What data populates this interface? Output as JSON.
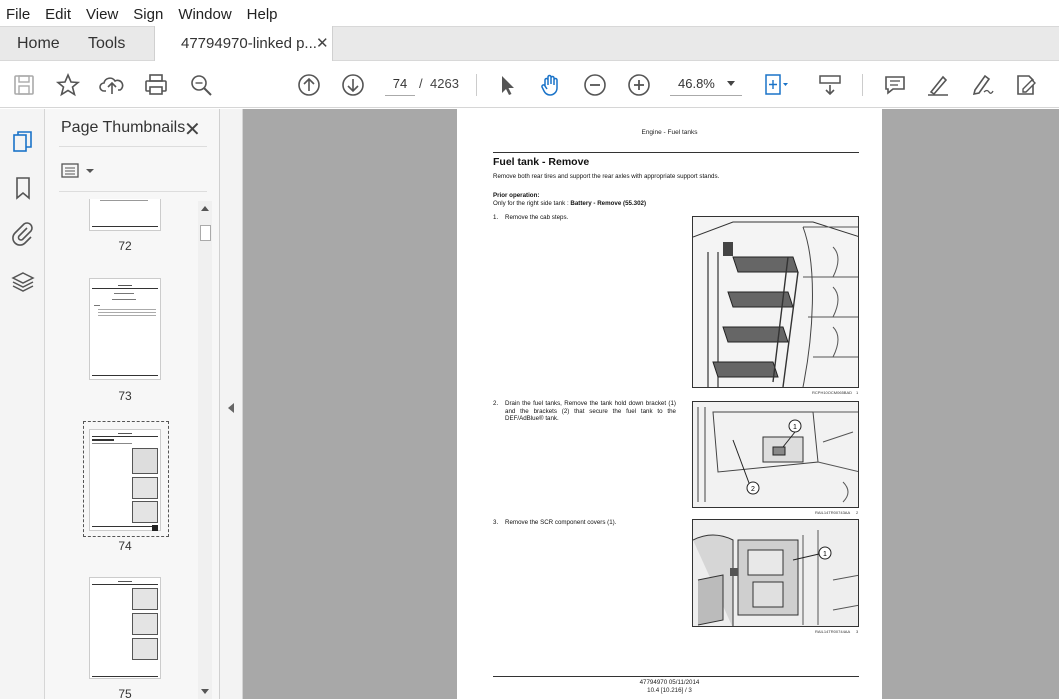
{
  "menu": [
    "File",
    "Edit",
    "View",
    "Sign",
    "Window",
    "Help"
  ],
  "tabs": {
    "home": "Home",
    "tools": "Tools",
    "doc": "47794970-linked p...",
    "close": "✕"
  },
  "toolbar": {
    "page_current": "74",
    "page_sep": "/",
    "page_total": "4263",
    "zoom": "46.8%"
  },
  "panel": {
    "title": "Page Thumbnails",
    "close": "✕"
  },
  "thumbnails": [
    {
      "num": "72"
    },
    {
      "num": "73"
    },
    {
      "num": "74",
      "selected": true
    },
    {
      "num": "75"
    }
  ],
  "document": {
    "header": "Engine - Fuel tanks",
    "title": "Fuel tank - Remove",
    "intro": "Remove both rear tires and support the rear axles with appropriate support stands.",
    "prior_label": "Prior operation:",
    "prior_text_pre": "Only for the right side tank : ",
    "prior_text_link": "Battery - Remove (55.302)",
    "steps": [
      {
        "num": "1.",
        "text": "Remove the cab steps.",
        "caption": "RCPH10OCM065BAD",
        "fig": "1"
      },
      {
        "num": "2.",
        "text": "Drain the fuel tanks, Remove the tank hold down bracket (1) and the brackets (2) that secure the fuel tank to the DEF/AdBlue® tank.",
        "caption": "RAIL14TR00743AA",
        "fig": "2"
      },
      {
        "num": "3.",
        "text": "Remove the SCR component covers (1).",
        "caption": "RAIL14TR00744AA",
        "fig": "3"
      }
    ],
    "footer_line1": "47794970 05/11/2014",
    "footer_line2": "10.4 [10.216] / 3"
  },
  "colors": {
    "accent": "#1a73c8",
    "doc_bg": "#a8a8a8"
  }
}
